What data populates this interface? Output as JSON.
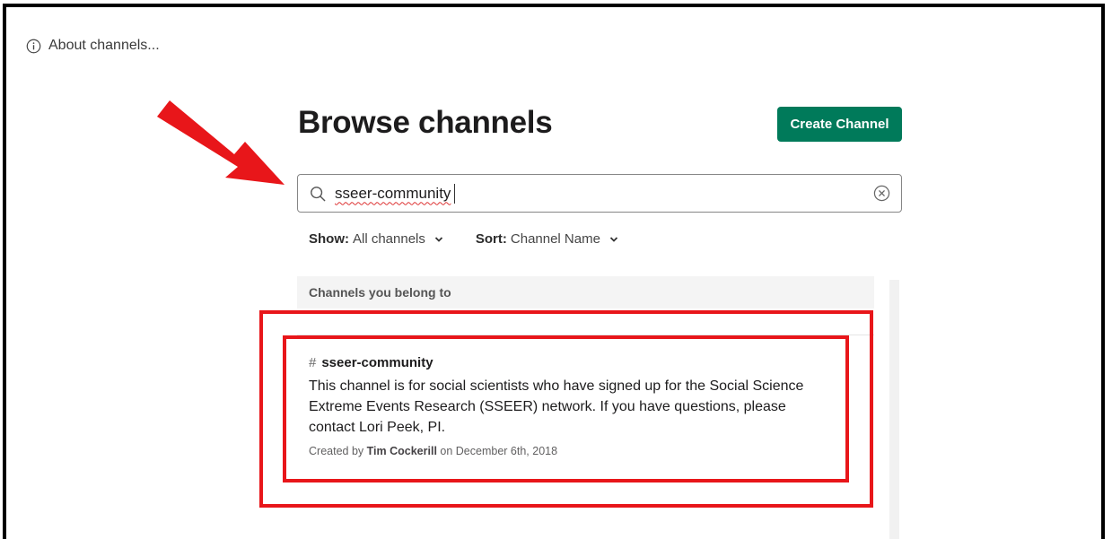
{
  "about": {
    "label": "About channels..."
  },
  "page": {
    "title": "Browse channels"
  },
  "actions": {
    "create_channel": "Create Channel"
  },
  "search": {
    "value": "sseer-community"
  },
  "filters": {
    "show_label": "Show:",
    "show_value": "All channels",
    "sort_label": "Sort:",
    "sort_value": "Channel Name"
  },
  "list": {
    "section_header": "Channels you belong to",
    "channels": [
      {
        "hash": "#",
        "name": "sseer-community",
        "description": "This channel is for social scientists who have signed up for the Social Science Extreme Events Research (SSEER) network. If you have questions, please contact Lori Peek, PI.",
        "created_prefix": "Created by",
        "creator": "Tim Cockerill",
        "created_on": "on December 6th, 2018"
      }
    ]
  },
  "colors": {
    "accent": "#007a5a",
    "annotation": "#e8161a"
  },
  "icons": [
    "info-icon",
    "search-icon",
    "clear-icon",
    "chevron-down-icon",
    "annotation-arrow"
  ]
}
